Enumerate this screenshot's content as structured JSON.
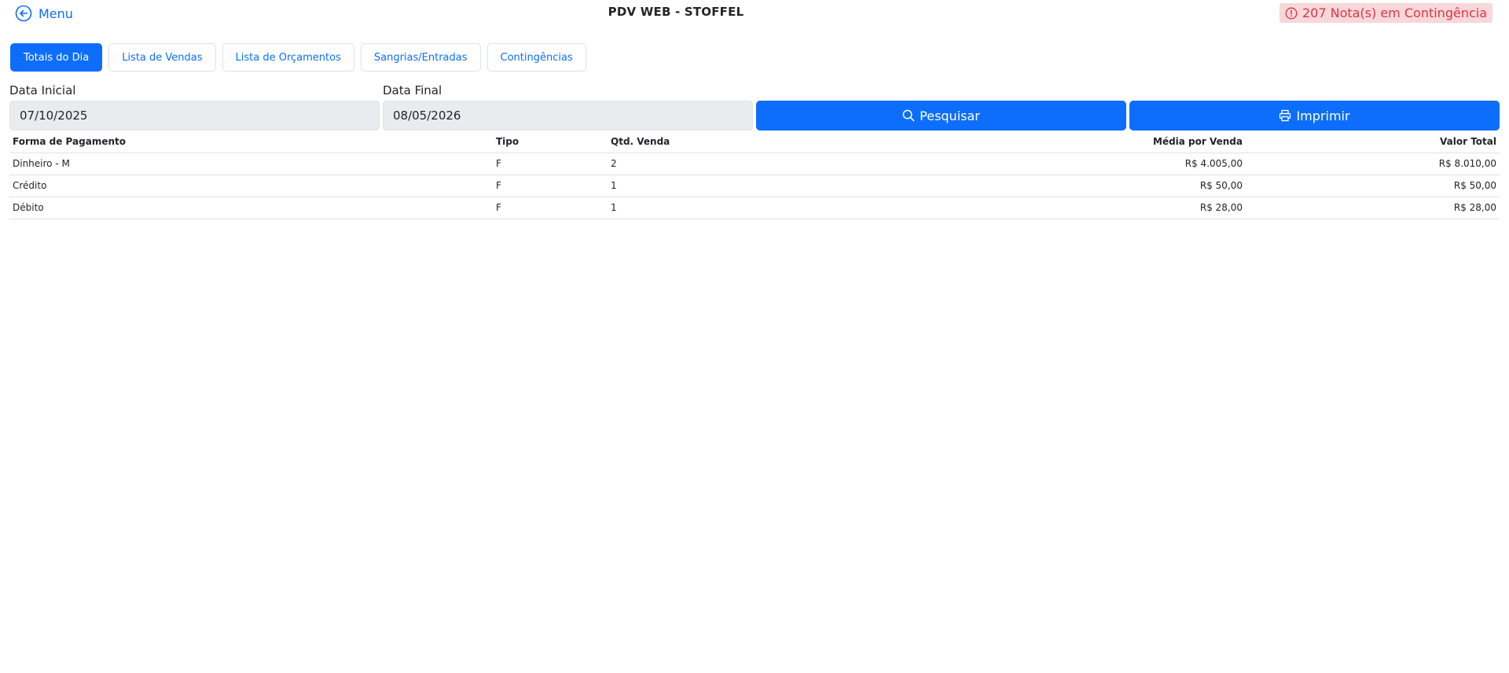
{
  "header": {
    "menu_label": "Menu",
    "title": "PDV WEB - STOFFEL",
    "contingency_badge": "207 Nota(s) em Contingência"
  },
  "tabs": [
    {
      "label": "Totais do Dia",
      "active": true
    },
    {
      "label": "Lista de Vendas",
      "active": false
    },
    {
      "label": "Lista de Orçamentos",
      "active": false
    },
    {
      "label": "Sangrias/Entradas",
      "active": false
    },
    {
      "label": "Contingências",
      "active": false
    }
  ],
  "filters": {
    "start_label": "Data Inicial",
    "start_value": "07/10/2025",
    "end_label": "Data Final",
    "end_value": "08/05/2026",
    "search_label": "Pesquisar",
    "print_label": "Imprimir"
  },
  "table": {
    "columns": [
      "Forma de Pagamento",
      "Tipo",
      "Qtd. Venda",
      "Média por Venda",
      "Valor Total"
    ],
    "rows": [
      [
        "Dinheiro - M",
        "F",
        "2",
        "R$ 4.005,00",
        "R$ 8.010,00"
      ],
      [
        "Crédito",
        "F",
        "1",
        "R$ 50,00",
        "R$ 50,00"
      ],
      [
        "Débito",
        "F",
        "1",
        "R$ 28,00",
        "R$ 28,00"
      ]
    ]
  },
  "colors": {
    "primary": "#0d6efd",
    "danger": "#dc3545",
    "danger_bg": "#f8d7da",
    "input_bg": "#e9ecef"
  },
  "icons": {
    "menu": "arrow-left-circle-icon",
    "badge": "exclamation-circle-icon",
    "search": "search-icon",
    "print": "printer-icon"
  }
}
